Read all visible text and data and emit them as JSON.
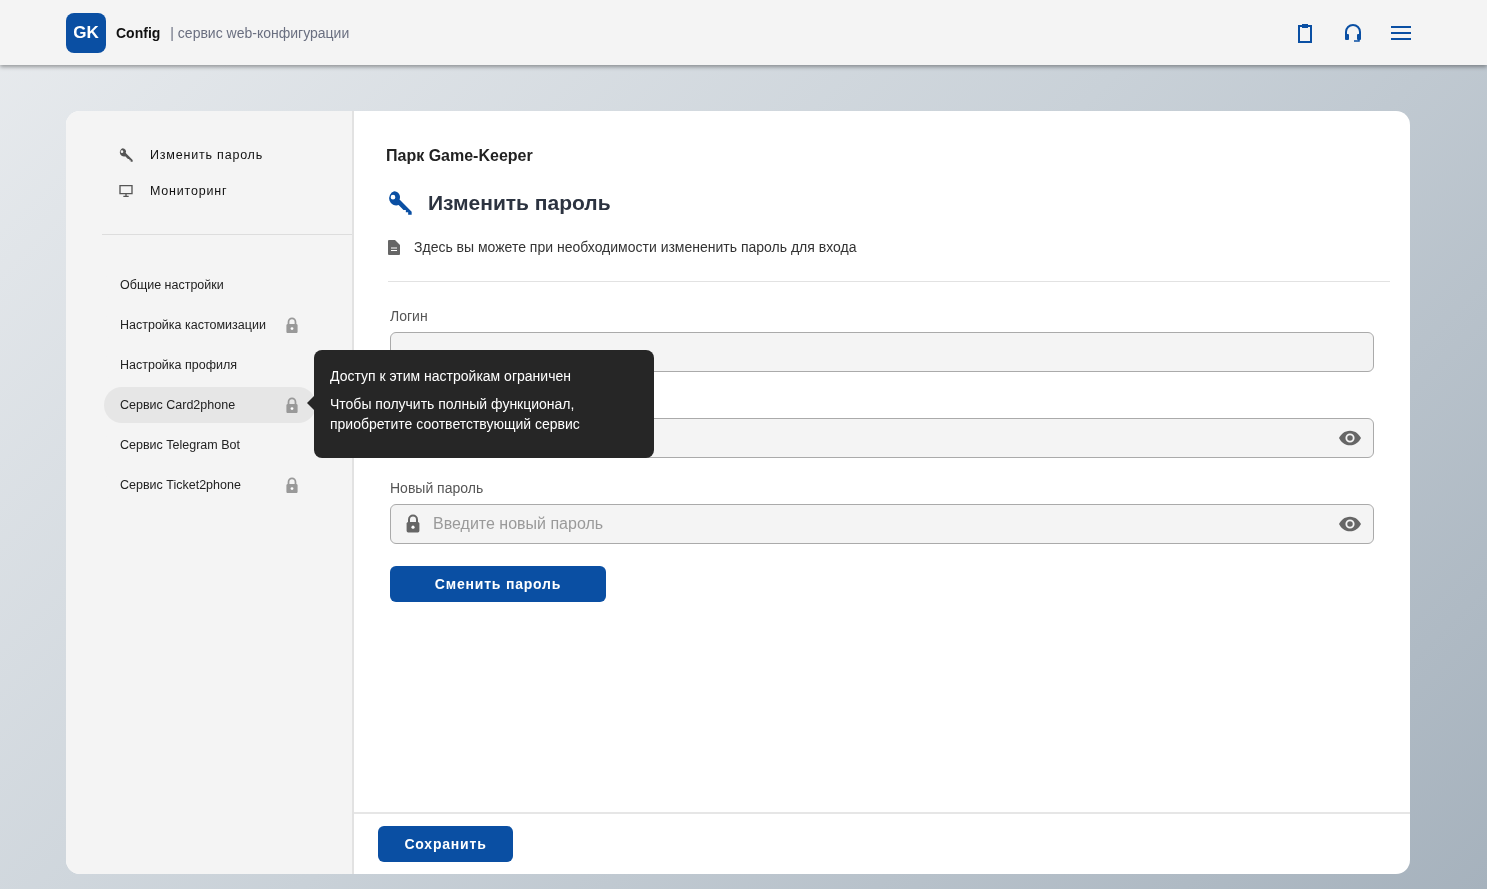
{
  "header": {
    "logo": "GK",
    "app_name": "Config",
    "separator": "|",
    "subtitle": "сервис web-конфигурации"
  },
  "sidebar": {
    "top_items": [
      {
        "label": "Изменить пароль",
        "kind": "key"
      },
      {
        "label": "Мониторинг",
        "kind": "monitor"
      }
    ],
    "items": [
      {
        "label": "Общие настройки",
        "locked": false,
        "selected": false
      },
      {
        "label": "Настройка кастомизации",
        "locked": true,
        "selected": false
      },
      {
        "label": "Настройка профиля",
        "locked": false,
        "selected": false
      },
      {
        "label": "Сервис Card2phone",
        "locked": true,
        "selected": true
      },
      {
        "label": "Сервис Telegram Bot",
        "locked": false,
        "selected": false
      },
      {
        "label": "Сервис Ticket2phone",
        "locked": true,
        "selected": false
      }
    ]
  },
  "tooltip": {
    "title": "Доступ к этим настройкам ограничен",
    "text": "Чтобы получить полный функционал, приобретите соответствующий сервис"
  },
  "content": {
    "park": "Парк Game-Keeper",
    "title": "Изменить пароль",
    "description": "Здесь вы можете при необходимости измененить пароль для входа",
    "fields": [
      {
        "label": "Логин",
        "kind": "login"
      },
      {
        "kind": "password"
      },
      {
        "label": "Новый пароль",
        "kind": "password",
        "placeholder": "Введите новый пароль"
      }
    ],
    "submit": "Сменить пароль"
  },
  "footer": {
    "save": "Сохранить"
  }
}
